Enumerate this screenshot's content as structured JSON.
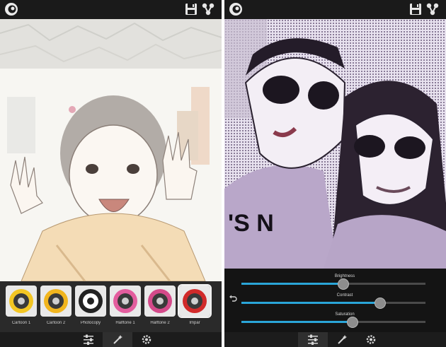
{
  "left": {
    "filters": [
      {
        "label": "Cartoon 1",
        "icon": "cartoon-1-filter-icon",
        "ring": "#f3c623"
      },
      {
        "label": "Cartoon 2",
        "icon": "cartoon-2-filter-icon",
        "ring": "#f1b51e"
      },
      {
        "label": "Photocopy",
        "icon": "photocopy-filter-icon",
        "ring": "#222222"
      },
      {
        "label": "Halftone 1",
        "icon": "halftone-1-filter-icon",
        "ring": "#e35d9e"
      },
      {
        "label": "Halftone 2",
        "icon": "halftone-2-filter-icon",
        "ring": "#d44a8a"
      },
      {
        "label": "Impar",
        "icon": "impar-filter-icon",
        "ring": "#d12a2a"
      }
    ],
    "nav": [
      {
        "name": "sliders-tab",
        "icon": "sliders-icon",
        "active": false
      },
      {
        "name": "effects-tab",
        "icon": "magic-wand-icon",
        "active": true
      },
      {
        "name": "settings-tab",
        "icon": "gear-icon",
        "active": false
      }
    ]
  },
  "right": {
    "sliders": [
      {
        "label": "Brightness",
        "value": 0.55
      },
      {
        "label": "Contrast",
        "value": 0.75
      },
      {
        "label": "Saturation",
        "value": 0.6
      }
    ],
    "nav": [
      {
        "name": "sliders-tab",
        "icon": "sliders-icon",
        "active": true
      },
      {
        "name": "effects-tab",
        "icon": "magic-wand-icon",
        "active": false
      },
      {
        "name": "settings-tab",
        "icon": "gear-icon",
        "active": false
      }
    ]
  },
  "colors": {
    "accent": "#2aa5d8",
    "bar": "#1a1a1a"
  }
}
